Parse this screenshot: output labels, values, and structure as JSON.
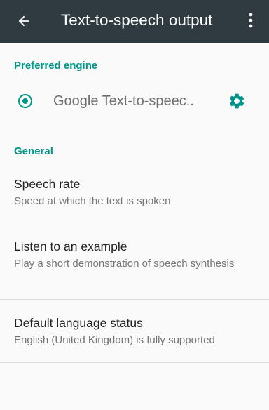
{
  "app_bar": {
    "title": "Text-to-speech output",
    "background": "#2f3a41",
    "back_icon": "arrow-back-icon",
    "overflow_icon": "more-vert-icon"
  },
  "accent_color": "#009688",
  "sections": {
    "preferred_engine": {
      "header": "Preferred engine",
      "engine": {
        "label": "Google Text-to-speec..",
        "selected": true,
        "settings_icon": "gear-icon"
      }
    },
    "general": {
      "header": "General",
      "items": [
        {
          "title": "Speech rate",
          "summary": "Speed at which the text is spoken"
        },
        {
          "title": "Listen to an example",
          "summary": "Play a short demonstration of speech synthesis"
        },
        {
          "title": "Default language status",
          "summary": "English (United Kingdom) is fully supported"
        }
      ]
    }
  }
}
